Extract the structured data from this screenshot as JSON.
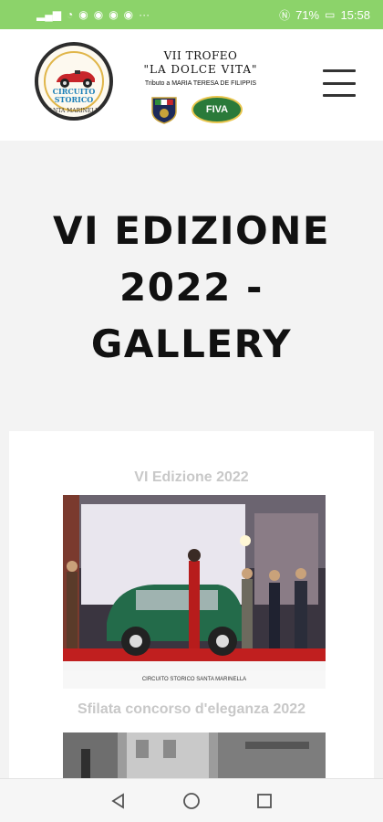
{
  "status_bar": {
    "battery_percent": "71%",
    "time": "15:58",
    "left_icons": [
      "signal-icon",
      "signal-icon",
      "wifi-icon",
      "whatsapp-icon",
      "whatsapp-icon",
      "app-icon",
      "app-icon",
      "app-icon",
      "more-icon"
    ],
    "bg_color": "#8cd36a"
  },
  "header": {
    "logo": {
      "line1": "CIRCUITO STORICO",
      "line2": "SANTA MARINELLA"
    },
    "trophy_line1": "VII TROFEO",
    "trophy_line2": "\"LA DOLCE VITA\"",
    "trophy_tribute": "Tributo a MARIA TERESA DE FILIPPIS",
    "badge_fiva": "FIVA",
    "menu_icon": "hamburger-menu-icon"
  },
  "hero": {
    "title": "VI EDIZIONE 2022 - GALLERY"
  },
  "gallery": {
    "section_title": "VI Edizione 2022",
    "photo_caption": "Sfilata concorso d'eleganza 2022",
    "photo_banner": "CIRCUITO STORICO SANTA MARINELLA"
  },
  "nav_bar": {
    "back_icon": "back-triangle-icon",
    "home_icon": "home-circle-icon",
    "recents_icon": "recents-square-icon"
  }
}
